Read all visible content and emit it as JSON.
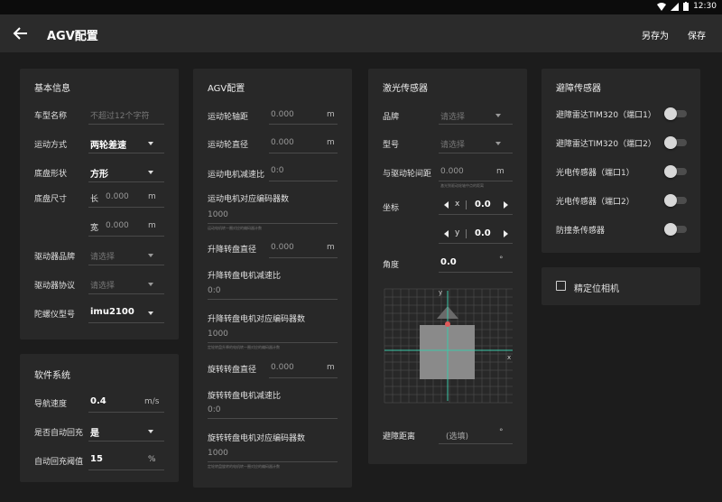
{
  "status": {
    "time": "12:30"
  },
  "header": {
    "title": "AGV配置",
    "save_as": "另存为",
    "save": "保存"
  },
  "basic": {
    "title": "基本信息",
    "model_name_label": "车型名称",
    "model_name_placeholder": "不超过12个字符",
    "motion_label": "运动方式",
    "motion_value": "两轮差速",
    "shape_label": "底盘形状",
    "shape_value": "方形",
    "size_label": "底盘尺寸",
    "length_label": "长",
    "length_value": "0.000",
    "length_unit": "m",
    "width_label": "宽",
    "width_value": "0.000",
    "width_unit": "m",
    "driver_brand_label": "驱动器品牌",
    "driver_brand_placeholder": "请选择",
    "driver_protocol_label": "驱动器协议",
    "driver_protocol_placeholder": "请选择",
    "gyro_label": "陀螺仪型号",
    "gyro_value": "imu2100"
  },
  "software": {
    "title": "软件系统",
    "nav_speed_label": "导航速度",
    "nav_speed_value": "0.4",
    "nav_speed_unit": "m/s",
    "auto_charge_label": "是否自动回充",
    "auto_charge_value": "是",
    "charge_threshold_label": "自动回充阈值",
    "charge_threshold_value": "15",
    "charge_threshold_unit": "%"
  },
  "agv": {
    "title": "AGV配置",
    "wheel_track_label": "运动轮轴距",
    "wheel_track_value": "0.000",
    "wheel_track_unit": "m",
    "wheel_diameter_label": "运动轮直径",
    "wheel_diameter_value": "0.000",
    "wheel_diameter_unit": "m",
    "motor_ratio_label": "运动电机减速比",
    "motor_ratio_value": "0:0",
    "motor_encoder_label": "运动电机对应编码器数",
    "motor_encoder_value": "1000",
    "motor_encoder_hint": "运动电机转一圈对应的编码器计数",
    "lift_diameter_label": "升降转盘直径",
    "lift_diameter_value": "0.000",
    "lift_diameter_unit": "m",
    "lift_ratio_label": "升降转盘电机减速比",
    "lift_ratio_value": "0:0",
    "lift_encoder_label": "升降转盘电机对应编码器数",
    "lift_encoder_value": "1000",
    "lift_encoder_hint": "定轮转盘升降的电机转一圈对应的编码器计数",
    "rotate_diameter_label": "旋转转盘直径",
    "rotate_diameter_value": "0.000",
    "rotate_diameter_unit": "m",
    "rotate_ratio_label": "旋转转盘电机减速比",
    "rotate_ratio_value": "0:0",
    "rotate_encoder_label": "旋转转盘电机对应编码器数",
    "rotate_encoder_value": "1000",
    "rotate_encoder_hint": "定轮转盘旋转的电机转一圈对应的编码器计数"
  },
  "laser": {
    "title": "激光传感器",
    "brand_label": "品牌",
    "brand_placeholder": "请选择",
    "model_label": "型号",
    "model_placeholder": "请选择",
    "distance_label": "与驱动轮间距",
    "distance_value": "0.000",
    "distance_unit": "m",
    "distance_hint": "激光到驱动轮轴中点的距离",
    "coord_label": "坐标",
    "x_label": "x",
    "x_value": "0.0",
    "y_label": "y",
    "y_value": "0.0",
    "angle_label": "角度",
    "angle_value": "0.0",
    "angle_unit": "°",
    "diagram_x": "x",
    "diagram_y": "y",
    "avoid_distance_label": "避障距离",
    "avoid_distance_placeholder": "(选填)",
    "avoid_distance_unit": "°"
  },
  "obstacle": {
    "title": "避障传感器",
    "items": [
      {
        "label": "避障雷达TIM320（端口1）",
        "on": false
      },
      {
        "label": "避障雷达TIM320（端口2）",
        "on": false
      },
      {
        "label": "光电传感器（端口1）",
        "on": false
      },
      {
        "label": "光电传感器（端口2）",
        "on": false
      },
      {
        "label": "防撞条传感器",
        "on": false
      }
    ]
  },
  "camera": {
    "label": "精定位相机",
    "checked": false
  },
  "colors": {
    "background": "#1c1c1c",
    "card": "#282828",
    "appbar": "#2b2b2b",
    "grid": "#555555",
    "axis": "#3cc8a8",
    "laser_dot": "#e05a5a"
  }
}
